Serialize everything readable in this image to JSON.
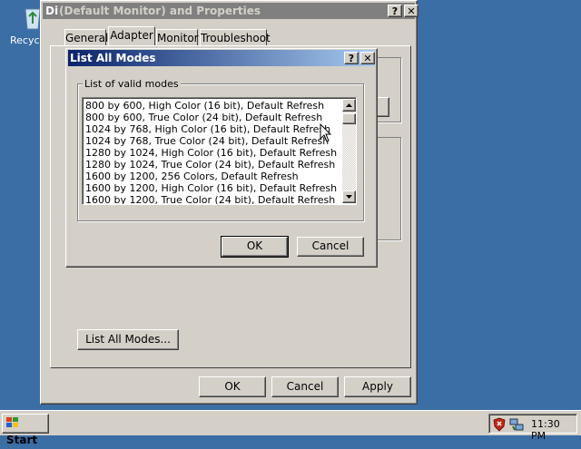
{
  "desktop": {
    "recycle_label": "Recycle"
  },
  "display_props": {
    "title_prefix": "Di",
    "title": "(Default Monitor) and  Properties",
    "help": "?",
    "close": "✕",
    "tabs": [
      "General",
      "Adapter",
      "Monitor",
      "Troubleshoot"
    ],
    "active_tab": "Adapter",
    "list_all_modes_label": "List All Modes...",
    "ok_label": "OK",
    "cancel_label": "Cancel",
    "apply_label": "Apply"
  },
  "list_modes": {
    "title": "List All Modes",
    "help": "?",
    "close": "✕",
    "group_label": "List of valid modes",
    "items": [
      "800 by 600, High Color (16 bit), Default Refresh",
      "800 by 600, True Color (24 bit), Default Refresh",
      "1024 by 768, High Color (16 bit), Default Refresh",
      "1024 by 768, True Color (24 bit), Default Refresh",
      "1280 by 1024, High Color (16 bit), Default Refresh",
      "1280 by 1024, True Color (24 bit), Default Refresh",
      "1600 by 1200, 256 Colors, Default Refresh",
      "1600 by 1200, High Color (16 bit), Default Refresh",
      "1600 by 1200, True Color (24 bit), Default Refresh"
    ],
    "ok_label": "OK",
    "cancel_label": "Cancel"
  },
  "taskbar": {
    "start_label": "Start",
    "clock": "11:30 PM"
  }
}
